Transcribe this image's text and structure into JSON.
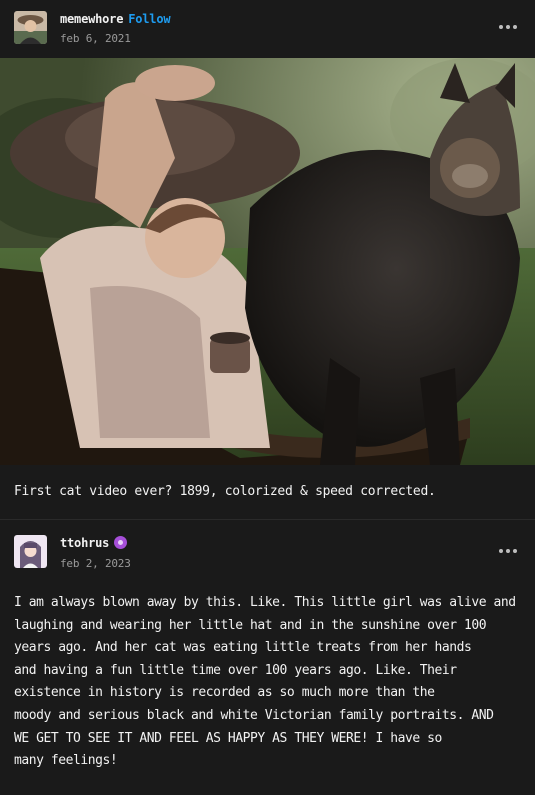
{
  "post": {
    "username": "memewhore",
    "follow_label": "Follow",
    "date": "feb 6, 2021",
    "more_icon": "ellipsis-icon",
    "caption": "First cat video ever?  1899, colorized & speed corrected."
  },
  "reply": {
    "username": "ttohrus",
    "badge_icon": "purple-badge-icon",
    "date": "feb 2, 2023",
    "more_icon": "ellipsis-icon",
    "body_lines": [
      "I am always blown away by this. Like. This little girl was alive and",
      "laughing and wearing her little hat and in the sunshine over 100",
      "years ago. And her cat was eating little treats from her hands",
      "and having a fun little time over 100 years ago. Like. Their",
      "existence in history is recorded as so much more than the",
      "moody and serious black and white Victorian family portraits. AND",
      "WE GET TO SEE IT AND FEEL AS HAPPY AS THEY WERE! I have so",
      "many feelings!"
    ]
  },
  "colors": {
    "background": "#1a1a1a",
    "follow": "#1e9cf0",
    "badge": "#a64fd9",
    "muted_text": "#9a9a9a"
  }
}
